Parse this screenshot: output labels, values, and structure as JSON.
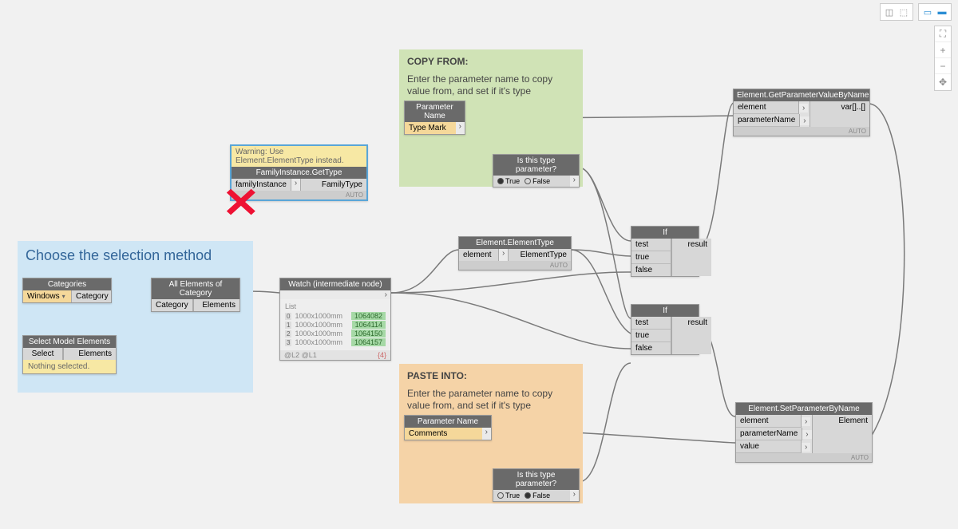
{
  "regions": {
    "selection": {
      "title": "Choose the selection method"
    },
    "copy_from": {
      "heading": "COPY FROM:",
      "desc": "Enter the parameter name to copy value from, and set if it's type parameter"
    },
    "paste_into": {
      "heading": "PASTE INTO:",
      "desc": "Enter the parameter name to copy value from, and set if it's type parameter"
    }
  },
  "nodes": {
    "categories": {
      "title": "Categories",
      "input": "Windows",
      "out": "Category"
    },
    "all_elements": {
      "title": "All Elements of Category",
      "in": "Category",
      "out": "Elements"
    },
    "select_model": {
      "title": "Select Model Elements",
      "btn": "Select",
      "out": "Elements",
      "status": "Nothing selected."
    },
    "family_gettype": {
      "title": "FamilyInstance.GetType",
      "warning": "Warning: Use Element.ElementType instead.",
      "in": "familyInstance",
      "out": "FamilyType",
      "footer": "AUTO"
    },
    "watch": {
      "title": "Watch (intermediate node)",
      "list_label": "List",
      "items": [
        {
          "idx": "0",
          "label": "1000x1000mm",
          "val": "1064082"
        },
        {
          "idx": "1",
          "label": "1000x1000mm",
          "val": "1064114"
        },
        {
          "idx": "2",
          "label": "1000x1000mm",
          "val": "1064150"
        },
        {
          "idx": "3",
          "label": "1000x1000mm",
          "val": "1064157"
        }
      ],
      "footer_left": "@L2 @L1",
      "footer_right": "{4}"
    },
    "elemtype": {
      "title": "Element.ElementType",
      "in": "element",
      "out": "ElementType",
      "footer": "AUTO"
    },
    "param_copy": {
      "title": "Parameter Name",
      "value": "Type Mark"
    },
    "bool_copy": {
      "title": "Is this type parameter?",
      "true": "True",
      "false": "False",
      "selected": "true"
    },
    "param_paste": {
      "title": "Parameter Name",
      "value": "Comments"
    },
    "bool_paste": {
      "title": "Is this type parameter?",
      "true": "True",
      "false": "False",
      "selected": "false"
    },
    "if1": {
      "title": "If",
      "test": "test",
      "true": "true",
      "false": "false",
      "out": "result"
    },
    "if2": {
      "title": "If",
      "test": "test",
      "true": "true",
      "false": "false",
      "out": "result"
    },
    "get_param": {
      "title": "Element.GetParameterValueByName",
      "in1": "element",
      "in2": "parameterName",
      "out": "var[]..[]",
      "footer": "AUTO"
    },
    "set_param": {
      "title": "Element.SetParameterByName",
      "in1": "element",
      "in2": "parameterName",
      "in3": "value",
      "out": "Element",
      "footer": "AUTO"
    }
  }
}
